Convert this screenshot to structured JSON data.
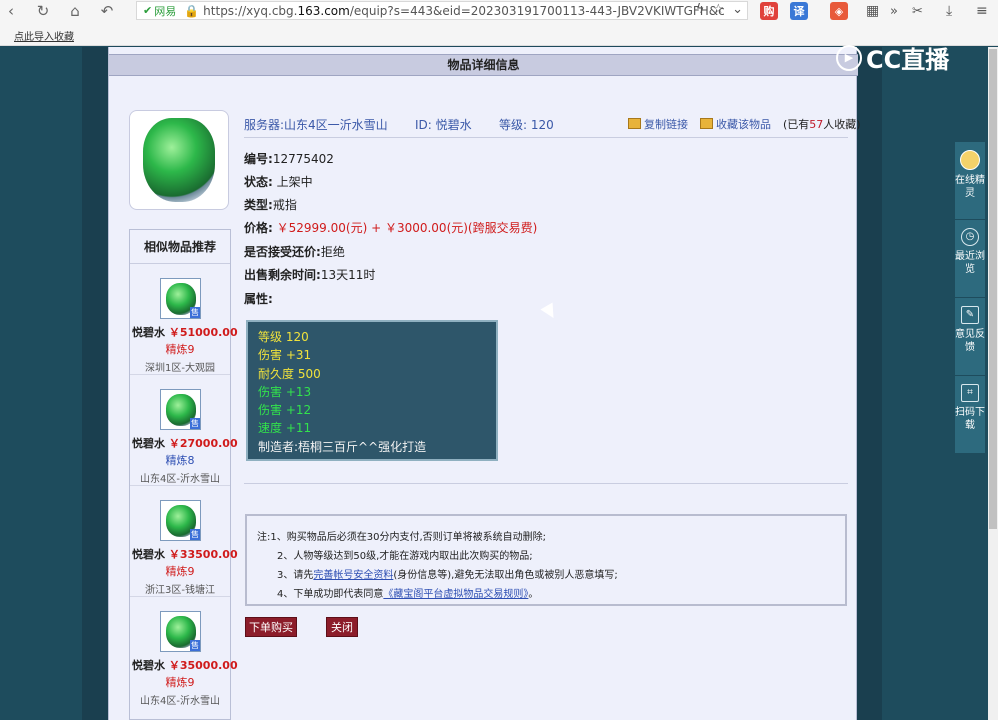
{
  "browser": {
    "secure_label": "网易",
    "url_prefix": "https://xyq.cbg.",
    "url_domain": "163.com",
    "url_suffix": "/equip?s=443&eid=202303191700113-443-JBV2VKIWTGFH&c",
    "bookmark": "点此导入收藏",
    "ext_buy": "购",
    "ext_translate": "译"
  },
  "watermark": {
    "brand": "CC直播"
  },
  "card": {
    "title": "物品详细信息"
  },
  "item": {
    "server_label": "服务器:",
    "server_value": "山东4区一沂水雪山",
    "id_label": "ID:",
    "id_value": "悦碧水",
    "level_label": "等级:",
    "level_value": "120",
    "copy_link": "复制链接",
    "favorite": "收藏该物品",
    "collected_prefix": "(已有",
    "collected_count": "57",
    "collected_suffix": "人收藏)",
    "serial_label": "编号:",
    "serial_value": "12775402",
    "status_label": "状态:",
    "status_value": "上架中",
    "type_label": "类型:",
    "type_value": "戒指",
    "price_label": "价格:",
    "price_value": "￥52999.00(元)  +  ￥3000.00(元)(跨服交易费)",
    "bargain_label": "是否接受还价:",
    "bargain_value": "拒绝",
    "remain_label": "出售剩余时间:",
    "remain_value": "13天11时",
    "attr_label": "属性:"
  },
  "attributes": {
    "level": "等级 120",
    "damage": "伤害 +31",
    "durability": "耐久度 500",
    "bonus1": "伤害 +13",
    "bonus2": "伤害 +12",
    "bonus3": "速度 +11",
    "maker": "制造者:梧桐三百斤^^强化打造"
  },
  "notice": {
    "line1": "注:1、购买物品后必须在30分内支付,否则订单将被系统自动删除;",
    "line2": "2、人物等级达到50级,才能在游戏内取出此次购买的物品;",
    "line3_pre": "3、请先",
    "line3_link": "完善帐号安全资料",
    "line3_post": "(身份信息等),避免无法取出角色或被别人恶意填写;",
    "line4_pre": "4、下单成功即代表同意",
    "line4_link": "《藏宝阁平台虚拟物品交易规则》",
    "line4_post": "。"
  },
  "buttons": {
    "buy": "下单购买",
    "close": "关闭"
  },
  "similar": {
    "title": "相似物品推荐",
    "items": [
      {
        "name": "悦碧水",
        "price": "￥51000.00",
        "refine": "精炼9",
        "server": "深圳1区-大观园",
        "refine_color": "#d01b1b",
        "tag": "售"
      },
      {
        "name": "悦碧水",
        "price": "￥27000.00",
        "refine": "精炼8",
        "server": "山东4区-沂水雪山",
        "refine_color": "#2e4fb3",
        "tag": "售"
      },
      {
        "name": "悦碧水",
        "price": "￥33500.00",
        "refine": "精炼9",
        "server": "浙江3区-钱塘江",
        "refine_color": "#d01b1b",
        "tag": "售"
      },
      {
        "name": "悦碧水",
        "price": "￥35000.00",
        "refine": "精炼9",
        "server": "山东4区-沂水雪山",
        "refine_color": "#d01b1b",
        "tag": "售"
      }
    ]
  },
  "float_panel": {
    "online": "在线精灵",
    "recent": "最近浏览",
    "feedback": "意见反馈",
    "scan": "扫码下载"
  }
}
